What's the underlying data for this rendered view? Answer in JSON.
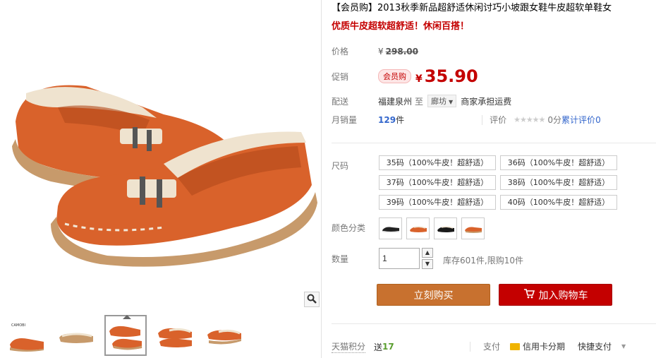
{
  "title": "【会员购】2013秋季新品超舒适休闲讨巧小坡跟女鞋牛皮超软单鞋女",
  "subtitle": "优质牛皮超软超舒适！休闲百搭！",
  "price": {
    "label": "价格",
    "currency": "¥",
    "value": "298.00"
  },
  "promo": {
    "label": "促销",
    "tag": "会员购",
    "currency": "¥",
    "value": "35.90"
  },
  "delivery": {
    "label": "配送",
    "from": "福建泉州",
    "to_word": "至",
    "to_city": "廊坊",
    "note": "商家承担运费"
  },
  "sales": {
    "label": "月销量",
    "count": "129",
    "unit": "件",
    "rating_label": "评价",
    "stars": "★★★★★",
    "score": "0分",
    "review_link": "累计评价",
    "review_count": "0"
  },
  "sizes": {
    "label": "尺码",
    "options": [
      "35码（100%牛皮！超舒适）",
      "36码（100%牛皮！超舒适）",
      "37码（100%牛皮！超舒适）",
      "38码（100%牛皮！超舒适）",
      "39码（100%牛皮！超舒适）",
      "40码（100%牛皮！超舒适）"
    ]
  },
  "colors": {
    "label": "颜色分类",
    "swatches": [
      "black-white",
      "orange-white",
      "black",
      "orange"
    ]
  },
  "quantity": {
    "label": "数量",
    "value": "1",
    "stock": "库存601件,限购10件"
  },
  "buttons": {
    "buy": "立刻购买",
    "cart": "加入购物车"
  },
  "footer": {
    "points_label": "天猫积分",
    "points_prefix": "送",
    "points": "17",
    "pay_label": "支付",
    "credit": "信用卡分期",
    "quick": "快捷支付"
  },
  "thumbnails": [
    "brand-card",
    "side-view",
    "pair-angled",
    "pair-top",
    "pair-side"
  ],
  "thumb_brand": "CAMOBI",
  "colors_hex": {
    "accent_red": "#c40000",
    "buy_orange": "#c8712f",
    "leather": "#d9622b"
  }
}
